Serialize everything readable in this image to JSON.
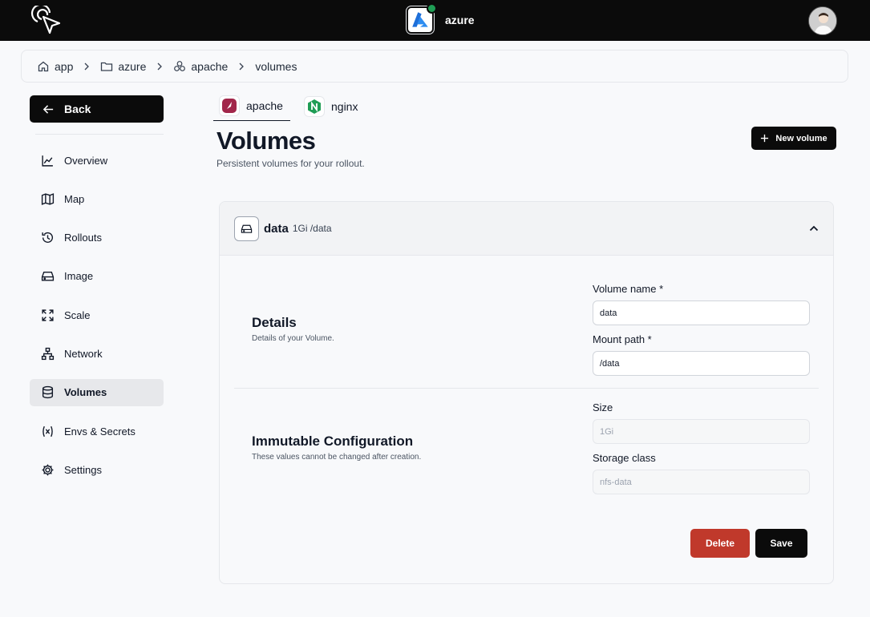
{
  "header": {
    "project_name": "azure",
    "colors": {
      "topbar": "#0b0b0b",
      "status_dot": "#1f9d55"
    }
  },
  "breadcrumb": [
    {
      "label": "app",
      "icon": "home-icon"
    },
    {
      "label": "azure",
      "icon": "folder-icon"
    },
    {
      "label": "apache",
      "icon": "cubes-icon"
    },
    {
      "label": "volumes"
    }
  ],
  "sidebar": {
    "back_label": "Back",
    "items": [
      {
        "label": "Overview",
        "icon": "chart-line-icon"
      },
      {
        "label": "Map",
        "icon": "map-icon"
      },
      {
        "label": "Rollouts",
        "icon": "history-icon"
      },
      {
        "label": "Image",
        "icon": "drive-icon"
      },
      {
        "label": "Scale",
        "icon": "expand-icon"
      },
      {
        "label": "Network",
        "icon": "network-icon"
      },
      {
        "label": "Volumes",
        "icon": "database-icon",
        "active": true
      },
      {
        "label": "Envs & Secrets",
        "icon": "variable-icon"
      },
      {
        "label": "Settings",
        "icon": "gear-icon"
      }
    ]
  },
  "tabs": [
    {
      "label": "apache",
      "active": true
    },
    {
      "label": "nginx",
      "active": false
    }
  ],
  "page": {
    "title": "Volumes",
    "subtitle": "Persistent volumes for your rollout.",
    "new_button": "New volume"
  },
  "volume": {
    "name": "data",
    "meta": "1Gi /data",
    "details": {
      "title": "Details",
      "description": "Details of your Volume.",
      "name_label": "Volume name *",
      "name_value": "data",
      "mount_label": "Mount path *",
      "mount_value": "/data"
    },
    "immutable": {
      "title": "Immutable Configuration",
      "description": "These values cannot be changed after creation.",
      "size_label": "Size",
      "size_value": "1Gi",
      "storage_label": "Storage class",
      "storage_value": "nfs-data"
    },
    "delete_label": "Delete",
    "save_label": "Save",
    "colors": {
      "delete": "#c0392b",
      "save": "#0b0b0b"
    }
  }
}
